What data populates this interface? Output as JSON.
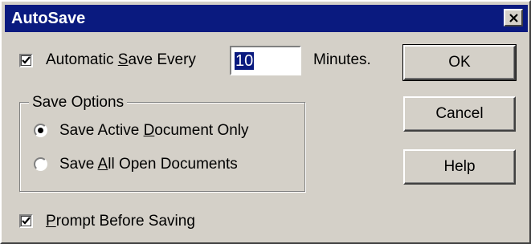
{
  "dialog": {
    "title": "AutoSave"
  },
  "autosave": {
    "label_pre": "Automatic ",
    "label_accel": "S",
    "label_post": "ave Every",
    "checked": true,
    "minutes_value": "10",
    "minutes_label": "Minutes."
  },
  "save_options": {
    "legend": "Save Options",
    "options": [
      {
        "pre": "Save Active ",
        "accel": "D",
        "post": "ocument Only",
        "selected": true
      },
      {
        "pre": "Save ",
        "accel": "A",
        "post": "ll Open Documents",
        "selected": false
      }
    ]
  },
  "prompt": {
    "accel": "P",
    "post": "rompt Before Saving",
    "checked": true
  },
  "buttons": {
    "ok": "OK",
    "cancel": "Cancel",
    "help": "Help"
  },
  "icons": {
    "close": "close-icon",
    "check": "checkmark-icon"
  },
  "colors": {
    "titlebar": "#0a1a7f",
    "face": "#d4d0c8",
    "selection": "#0a1a7f"
  }
}
